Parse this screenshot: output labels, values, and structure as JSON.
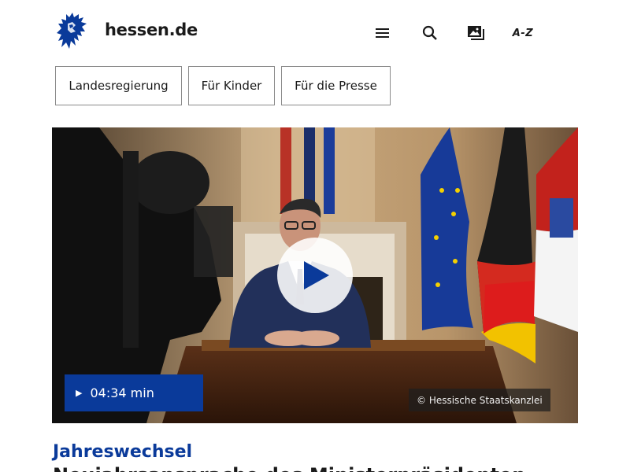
{
  "header": {
    "site_title": "hessen.de",
    "icons": [
      "lion-crest-logo",
      "menu-icon",
      "search-icon",
      "gallery-icon",
      "a-z-index-icon"
    ],
    "az_label": "A-Z"
  },
  "nav": {
    "items": [
      {
        "label": "Landesregierung"
      },
      {
        "label": "Für Kinder"
      },
      {
        "label": "Für die Presse"
      }
    ]
  },
  "hero": {
    "duration": "04:34 min",
    "credit": "© Hessische Staatskanzlei",
    "colors": {
      "brand_blue": "#0a3a9a"
    }
  },
  "article": {
    "kicker": "Jahreswechsel",
    "headline": "Neujahrsansprache des Ministerpräsidenten"
  }
}
